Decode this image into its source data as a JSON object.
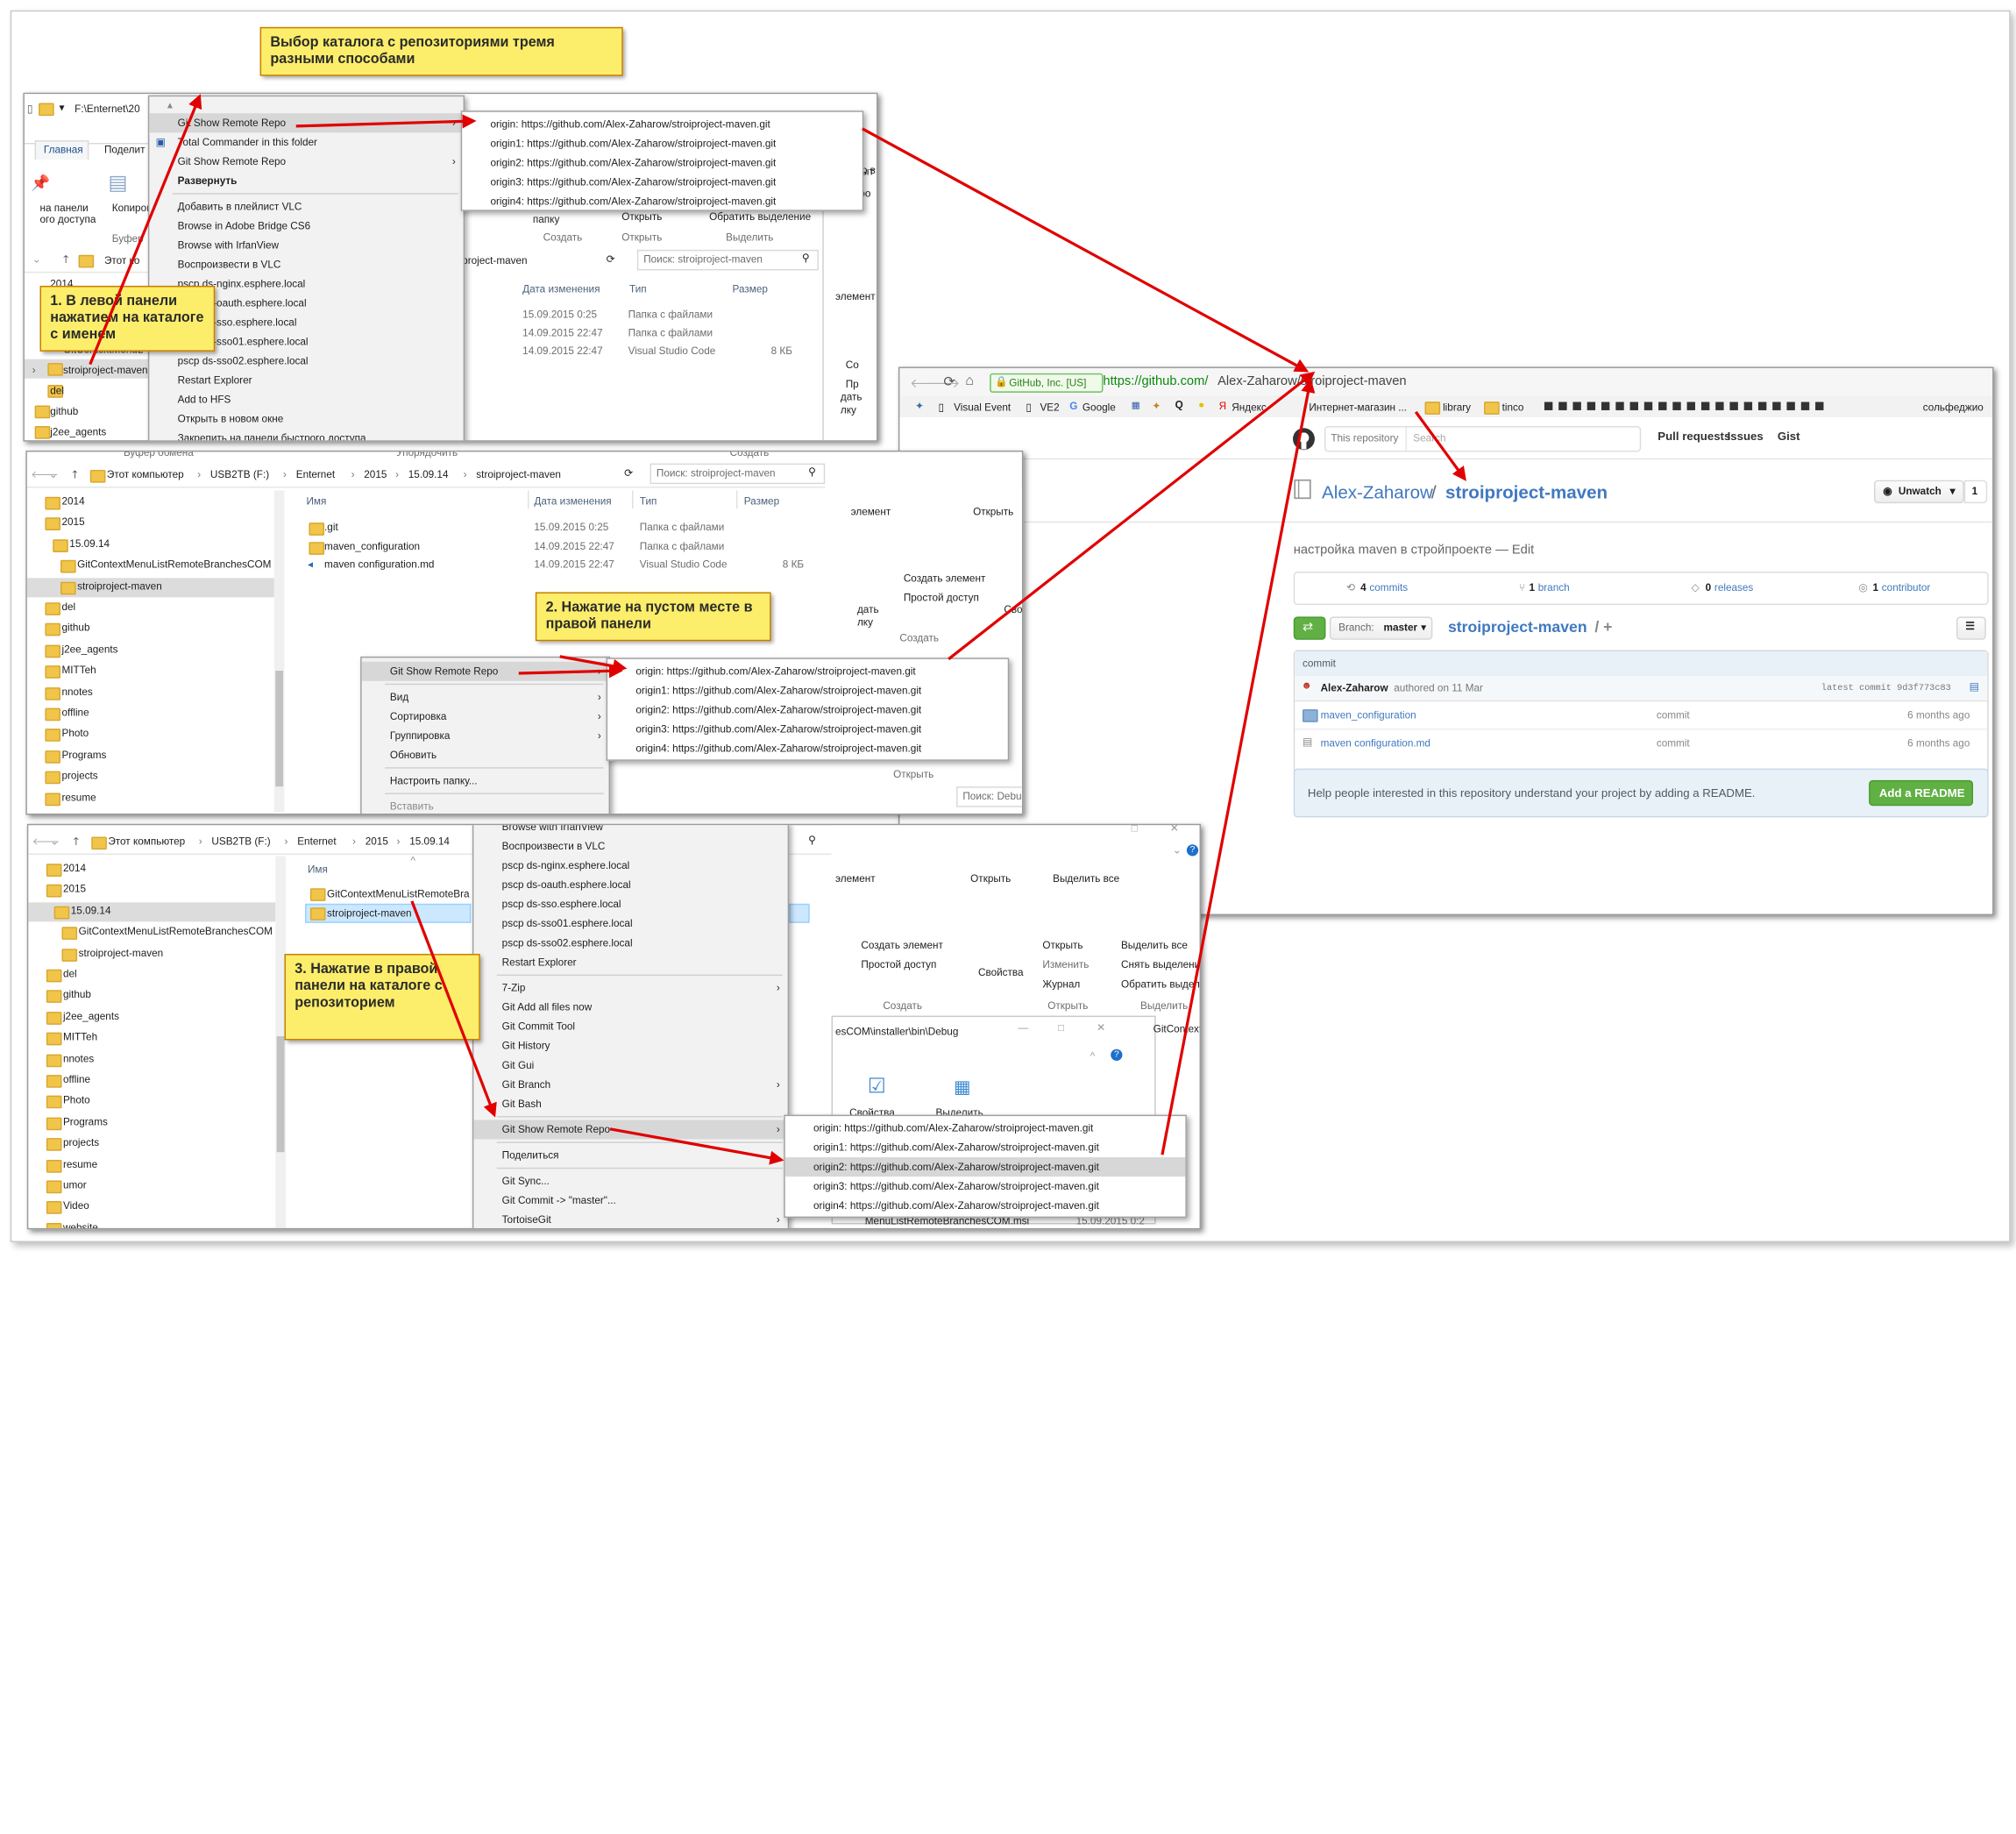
{
  "colors": {
    "arrow": "#e00000",
    "note_bg": "#fcee6a",
    "note_border": "#c77d00",
    "folder": "#f0c54a",
    "github_link": "#4078c0",
    "github_green": "#55a532"
  },
  "notes": {
    "top": "Выбор каталога с репозиториями тремя разными способами",
    "n1": "1. В левой панели нажатием на каталоге с именем",
    "n2": "2. Нажатие на пустом месте в правой панели",
    "n3": "3. Нажатие в правой панели на каталоге с репозиторием"
  },
  "remotes": [
    "origin: https://github.com/Alex-Zaharow/stroiproject-maven.git",
    "origin1: https://github.com/Alex-Zaharow/stroiproject-maven.git",
    "origin2: https://github.com/Alex-Zaharow/stroiproject-maven.git",
    "origin3: https://github.com/Alex-Zaharow/stroiproject-maven.git",
    "origin4: https://github.com/Alex-Zaharow/stroiproject-maven.git"
  ],
  "shot1": {
    "path": "F:\\Enternet\\20",
    "tab_home": "Главная",
    "tab_share": "Поделит",
    "pin_label1": "на панели",
    "pin_label2": "ого доступа",
    "copy_label": "Копироват",
    "buffer_label": "Буфер",
    "breadcrumb": "Этот ко",
    "tree": [
      "stroiproject-maven",
      "del",
      "github",
      "j2ee_agents"
    ],
    "tree_partial": [
      "2014",
      "2015",
      "GitContextMenuL"
    ],
    "menu": [
      {
        "label": "Git Show Remote Repo",
        "arrow": true,
        "hl": true
      },
      {
        "label": "Total Commander in this folder",
        "icon": true
      },
      {
        "label": "Git Show Remote Repo",
        "arrow": true
      },
      {
        "label": "Развернуть",
        "bold": true
      },
      {
        "label": "Добавить в плейлист VLC"
      },
      {
        "label": "Browse in Adobe Bridge CS6"
      },
      {
        "label": "Browse with IrfanView"
      },
      {
        "label": "Воспроизвести в VLC"
      },
      {
        "label": "pscp ds-nginx.esphere.local"
      },
      {
        "label": "pscp ds-oauth.esphere.local"
      },
      {
        "label": "pscp ds-sso.esphere.local"
      },
      {
        "label": "pscp ds-sso01.esphere.local"
      },
      {
        "label": "pscp ds-sso02.esphere.local"
      },
      {
        "label": "Restart Explorer"
      },
      {
        "label": "Add to HFS"
      },
      {
        "label": "Открыть в новом окне"
      },
      {
        "label": "Закрепить на панели быстрого доступа"
      }
    ],
    "bg": {
      "folder_btn": "папку",
      "open_btn": "Открыть",
      "select_all": "Обратить выделение",
      "create_label": "Создать",
      "open_label": "Открыть",
      "select_label": "Выделить",
      "path": "project-maven",
      "search": "Поиск: stroiproject-maven",
      "cols": [
        "Дата изменения",
        "Тип",
        "Размер"
      ],
      "rows": [
        [
          "15.09.2015 0:25",
          "Папка с файлами",
          ""
        ],
        [
          "14.09.2015 22:47",
          "Папка с файлами",
          ""
        ],
        [
          "14.09.2015 22:47",
          "Visual Studio Code",
          "8 КБ"
        ]
      ],
      "right_partial": [
        "элемент",
        "Со",
        "Пр",
        "дать",
        "лку",
        "рыт",
        "пр в",
        "тро"
      ]
    }
  },
  "shot2": {
    "top_strip": [
      "Буфер обмена",
      "Упорядочить",
      "Создать"
    ],
    "breadcrumb": [
      "Этот компьютер",
      "USB2TB (F:)",
      "Enternet",
      "2015",
      "15.09.14",
      "stroiproject-maven"
    ],
    "search": "Поиск: stroiproject-maven",
    "tree": [
      "2014",
      "2015",
      "15.09.14",
      "GitContextMenuListRemoteBranchesCOM",
      "stroiproject-maven",
      "del",
      "github",
      "j2ee_agents",
      "MITTeh",
      "nnotes",
      "offline",
      "Photo",
      "Programs",
      "projects",
      "resume"
    ],
    "cols": [
      "Имя",
      "Дата изменения",
      "Тип",
      "Размер"
    ],
    "files": [
      {
        "name": ".git",
        "date": "15.09.2015 0:25",
        "type": "Папка с файлами",
        "size": ""
      },
      {
        "name": "maven_configuration",
        "date": "14.09.2015 22:47",
        "type": "Папка с файлами",
        "size": ""
      },
      {
        "name": "maven configuration.md",
        "date": "14.09.2015 22:47",
        "type": "Visual Studio Code",
        "size": "8 КБ"
      }
    ],
    "menu": [
      {
        "label": "Git Show Remote Repo",
        "arrow": true,
        "hl": true
      },
      {
        "label": "Вид",
        "arrow": true
      },
      {
        "label": "Сортировка",
        "arrow": true
      },
      {
        "label": "Группировка",
        "arrow": true
      },
      {
        "label": "Обновить"
      },
      {
        "label": "Настроить папку..."
      },
      {
        "label": "Вставить",
        "gray": true
      }
    ],
    "bg": {
      "element_btn": "элемент",
      "open_btn": "Открыть",
      "create_elem": "Создать элемент",
      "easy_access": "Простой доступ",
      "props": "Свойства",
      "create_label": "Создать",
      "open_label": "Открыть",
      "search2": "Поиск: Debug",
      "partial": [
        "дать",
        "лку"
      ]
    }
  },
  "shot3": {
    "breadcrumb": [
      "Этот компьютер",
      "USB2TB (F:)",
      "Enternet",
      "2015",
      "15.09.14"
    ],
    "tree": [
      "2014",
      "2015",
      "15.09.14",
      "GitContextMenuListRemoteBranchesCOM",
      "stroiproject-maven",
      "del",
      "github",
      "j2ee_agents",
      "MITTeh",
      "nnotes",
      "offline",
      "Photo",
      "Programs",
      "projects",
      "resume",
      "umor",
      "Video",
      "website"
    ],
    "col_name": "Имя",
    "files": [
      "GitContextMenuListRemoteBra",
      "stroiproject-maven"
    ],
    "menu": [
      {
        "label": "Browse with IrfanView"
      },
      {
        "label": "Воспроизвести в VLC"
      },
      {
        "label": "pscp ds-nginx.esphere.local"
      },
      {
        "label": "pscp ds-oauth.esphere.local"
      },
      {
        "label": "pscp ds-sso.esphere.local"
      },
      {
        "label": "pscp ds-sso01.esphere.local"
      },
      {
        "label": "pscp ds-sso02.esphere.local"
      },
      {
        "label": "Restart Explorer"
      },
      {
        "label": "7-Zip",
        "arrow": true
      },
      {
        "label": "Git Add all files now"
      },
      {
        "label": "Git Commit Tool"
      },
      {
        "label": "Git History"
      },
      {
        "label": "Git Gui"
      },
      {
        "label": "Git Branch",
        "arrow": true
      },
      {
        "label": "Git Bash"
      },
      {
        "label": "Git Show Remote Repo",
        "arrow": true,
        "hl": true
      },
      {
        "label": "Поделиться"
      },
      {
        "label": "Git Sync..."
      },
      {
        "label": "Git Commit -> \"master\"..."
      },
      {
        "label": "TortoiseGit",
        "arrow": true
      }
    ],
    "bg": {
      "element": "элемент",
      "open": "Открыть",
      "select_all": "Выделить все",
      "create_elem": "Создать элемент",
      "easy_access": "Простой доступ",
      "props": "Свойства",
      "open_btn": "Открыть",
      "edit": "Изменить",
      "journal": "Журнал",
      "select_all2": "Выделить все",
      "remove_sel": "Снять выделени",
      "invert_sel": "Обратить выделе",
      "create_label": "Создать",
      "open_label": "Открыть",
      "select_label": "Выделить",
      "small_path": "esCOM\\installer\\bin\\Debug",
      "small_props": "Свойства",
      "small_select": "Выделить",
      "gitctx": "GitContextMen",
      "msi": "MenuListRemoteBranchesCOM.msi",
      "msi_date": "15.09.2015 0:2"
    }
  },
  "browser": {
    "cert": "GitHub, Inc. [US]",
    "url_prefix": "https://github.com/",
    "url_path": "Alex-Zaharow/stroiproject-maven",
    "bookmarks": [
      "Visual Event",
      "VE2",
      "Google",
      "Яндекс",
      "Интернет-магазин ...",
      "library",
      "tinco",
      "сольфеджио"
    ],
    "search_scope": "This repository",
    "search_placeholder": "Search",
    "nav": [
      "Pull requests",
      "Issues",
      "Gist"
    ],
    "owner": "Alex-Zaharow",
    "slash": "/",
    "repo": "stroiproject-maven",
    "unwatch": "Unwatch",
    "watch_count": "1",
    "description": "настройка maven в стройпроекте — Edit",
    "stats": [
      {
        "num": "4",
        "label": "commits",
        "icon": "commits-icon"
      },
      {
        "num": "1",
        "label": "branch",
        "icon": "branch-icon"
      },
      {
        "num": "0",
        "label": "releases",
        "icon": "tag-icon"
      },
      {
        "num": "1",
        "label": "contributor",
        "icon": "contributors-icon"
      }
    ],
    "branch_label": "Branch:",
    "branch_name": "master",
    "repo_path": "stroiproject-maven",
    "path_plus": "/ +",
    "commit_title": "commit",
    "commit_author": "Alex-Zaharow",
    "commit_meta": "authored on 11 Mar",
    "latest_commit": "latest commit 9d3f773c83",
    "files": [
      {
        "name": "maven_configuration",
        "msg": "commit",
        "age": "6 months ago",
        "kind": "folder"
      },
      {
        "name": "maven configuration.md",
        "msg": "commit",
        "age": "6 months ago",
        "kind": "file"
      }
    ],
    "readme_text": "Help people interested in this repository understand your project by adding a README.",
    "readme_btn": "Add a README"
  }
}
